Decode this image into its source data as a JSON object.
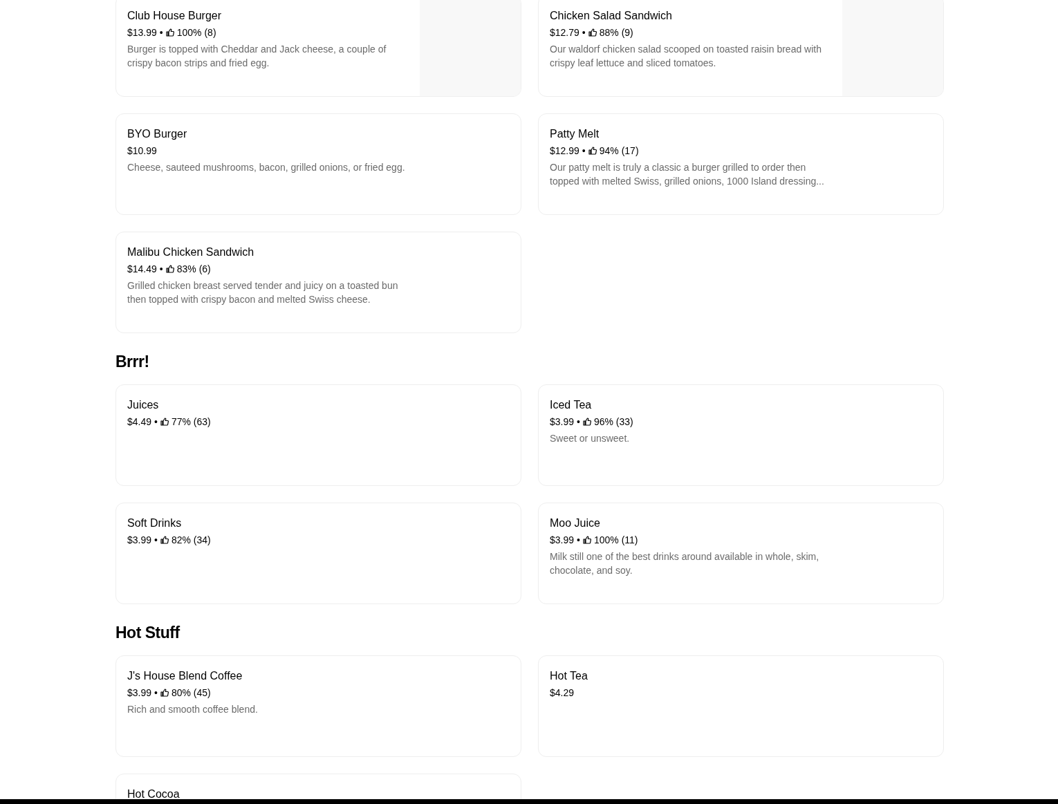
{
  "separator": "•",
  "sections": [
    {
      "items": [
        {
          "name": "Club House Burger",
          "price": "$13.99",
          "rating": "100%",
          "reviews": "(8)",
          "description": "Burger is topped with Cheddar and Jack cheese, a couple of crispy bacon strips and fried egg.",
          "image": true
        },
        {
          "name": "Chicken Salad Sandwich",
          "price": "$12.79",
          "rating": "88%",
          "reviews": "(9)",
          "description": "Our waldorf chicken salad scooped on toasted raisin bread with crispy leaf lettuce and sliced tomatoes.",
          "image": true
        },
        {
          "name": "BYO Burger",
          "price": "$10.99",
          "description": "Cheese, sauteed mushrooms, bacon, grilled onions, or fried egg."
        },
        {
          "name": "Patty Melt",
          "price": "$12.99",
          "rating": "94%",
          "reviews": "(17)",
          "description": "Our patty melt is truly a classic a burger grilled to order then topped with melted Swiss, grilled onions, 1000 Island dressing..."
        },
        {
          "name": "Malibu Chicken Sandwich",
          "price": "$14.49",
          "rating": "83%",
          "reviews": "(6)",
          "description": "Grilled chicken breast served tender and juicy on a toasted bun then topped with crispy bacon and melted Swiss cheese."
        }
      ]
    },
    {
      "heading": "Brrr!",
      "items": [
        {
          "name": "Juices",
          "price": "$4.49",
          "rating": "77%",
          "reviews": "(63)"
        },
        {
          "name": "Iced Tea",
          "price": "$3.99",
          "rating": "96%",
          "reviews": "(33)",
          "description": "Sweet or unsweet."
        },
        {
          "name": "Soft Drinks",
          "price": "$3.99",
          "rating": "82%",
          "reviews": "(34)"
        },
        {
          "name": "Moo Juice",
          "price": "$3.99",
          "rating": "100%",
          "reviews": "(11)",
          "description": "Milk still one of the best drinks around available in whole, skim, chocolate, and soy."
        }
      ]
    },
    {
      "heading": "Hot Stuff",
      "items": [
        {
          "name": "J's House Blend Coffee",
          "price": "$3.99",
          "rating": "80%",
          "reviews": "(45)",
          "description": "Rich and smooth coffee blend."
        },
        {
          "name": "Hot Tea",
          "price": "$4.29"
        },
        {
          "name": "Hot Cocoa"
        }
      ]
    }
  ]
}
